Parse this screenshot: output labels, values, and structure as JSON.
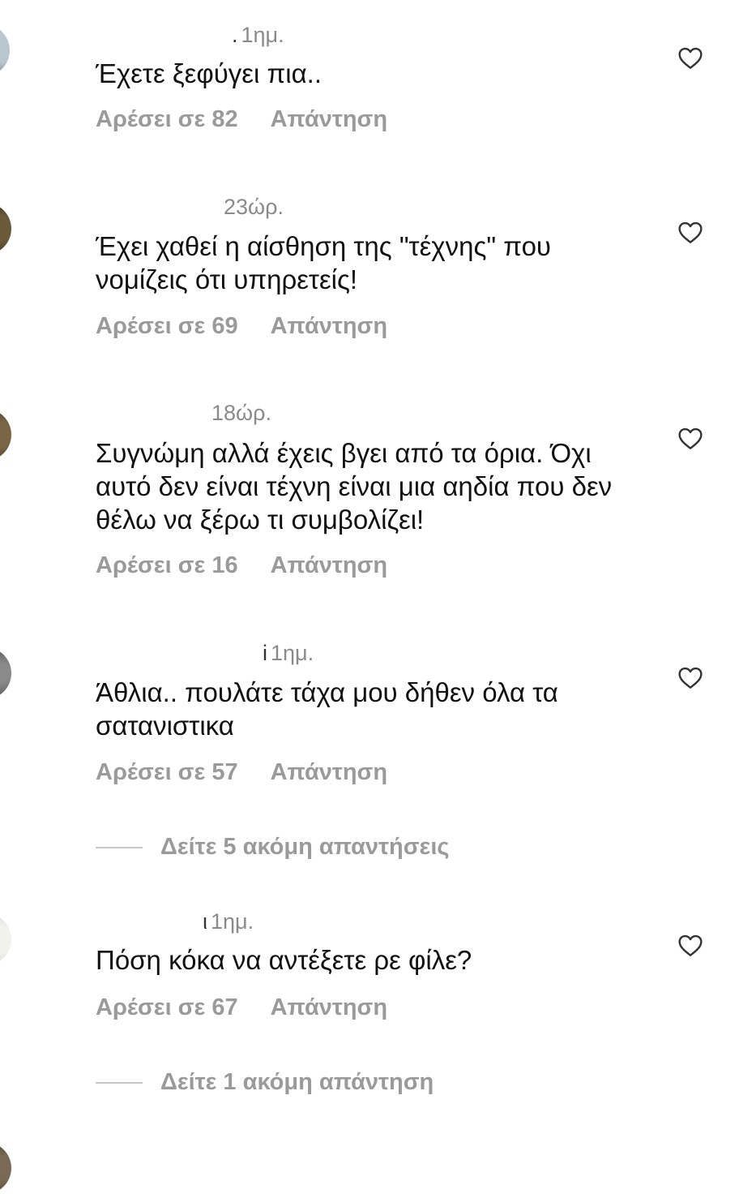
{
  "comments": [
    {
      "time_prefix": ".",
      "time": "1ημ.",
      "text": "Έχετε ξεφύγει πια..",
      "likes": "Αρέσει σε 82",
      "reply": "Απάντηση"
    },
    {
      "time_prefix": "",
      "time": "23ώρ.",
      "text": "Έχει χαθεί η αίσθηση της \"τέχνης\" που νομίζεις ότι υπηρετείς!",
      "likes": "Αρέσει σε 69",
      "reply": "Απάντηση"
    },
    {
      "time_prefix": "",
      "time": "18ώρ.",
      "text": "Συγνώμη αλλά έχεις βγει από τα όρια. Όχι αυτό δεν είναι τέχνη είναι μια αηδία που δεν θέλω να ξέρω τι συμβολίζει!",
      "likes": "Αρέσει σε 16",
      "reply": "Απάντηση"
    },
    {
      "time_prefix": "i",
      "time": "1ημ.",
      "text": "Άθλια.. πουλάτε τάχα μου δήθεν όλα τα σατανιστικα",
      "likes": "Αρέσει σε 57",
      "reply": "Απάντηση",
      "view_more": "Δείτε 5 ακόμη απαντήσεις"
    },
    {
      "time_prefix": "ι",
      "time": "1ημ.",
      "text": "Πόση κόκα να αντέξετε ρε φίλε?",
      "likes": "Αρέσει σε 67",
      "reply": "Απάντηση",
      "view_more": "Δείτε 1 ακόμη απάντηση"
    }
  ],
  "icons": {
    "like": "heart-outline-icon"
  },
  "colors": {
    "text": "#111111",
    "meta": "#8a8a8a",
    "actions": "#9a9a9a",
    "divider": "#c8c8c8"
  }
}
